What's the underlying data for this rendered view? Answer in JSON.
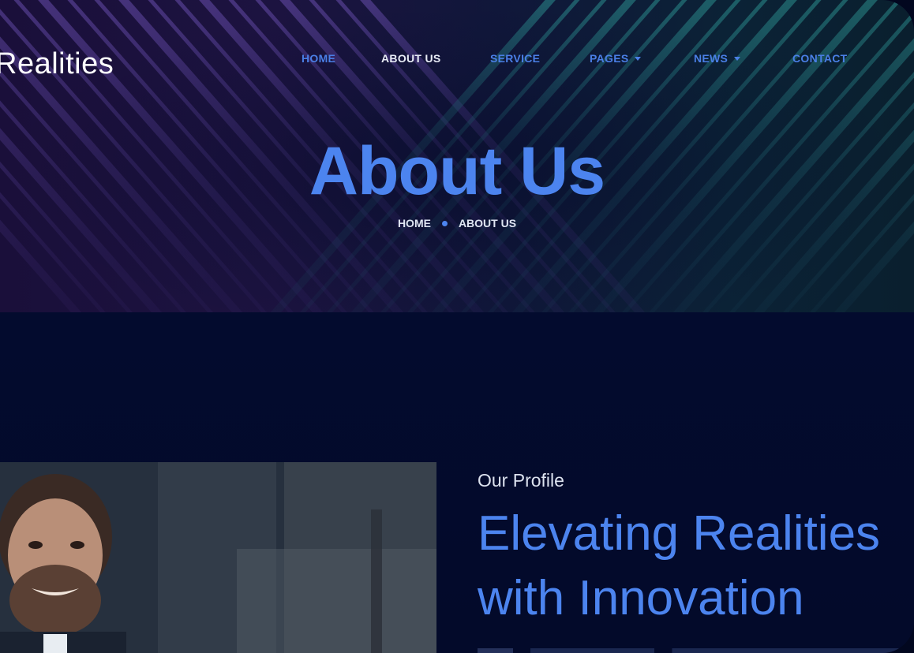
{
  "brand": {
    "name": "Realities"
  },
  "nav": {
    "items": [
      {
        "label": "HOME",
        "has_dropdown": false,
        "active": false
      },
      {
        "label": "ABOUT US",
        "has_dropdown": false,
        "active": true
      },
      {
        "label": "SERVICE",
        "has_dropdown": false,
        "active": false
      },
      {
        "label": "PAGES",
        "has_dropdown": true,
        "active": false
      },
      {
        "label": "NEWS",
        "has_dropdown": true,
        "active": false
      },
      {
        "label": "CONTACT",
        "has_dropdown": false,
        "active": false
      }
    ]
  },
  "hero": {
    "title": "About Us",
    "breadcrumb": [
      "HOME",
      "ABOUT US"
    ]
  },
  "profile": {
    "eyebrow": "Our Profile",
    "headline_line1": "Elevating Realities",
    "headline_line2": "with Innovation"
  },
  "colors": {
    "accent": "#4c84ef",
    "background": "#030a2a",
    "nav_active": "#e8ecf6"
  }
}
